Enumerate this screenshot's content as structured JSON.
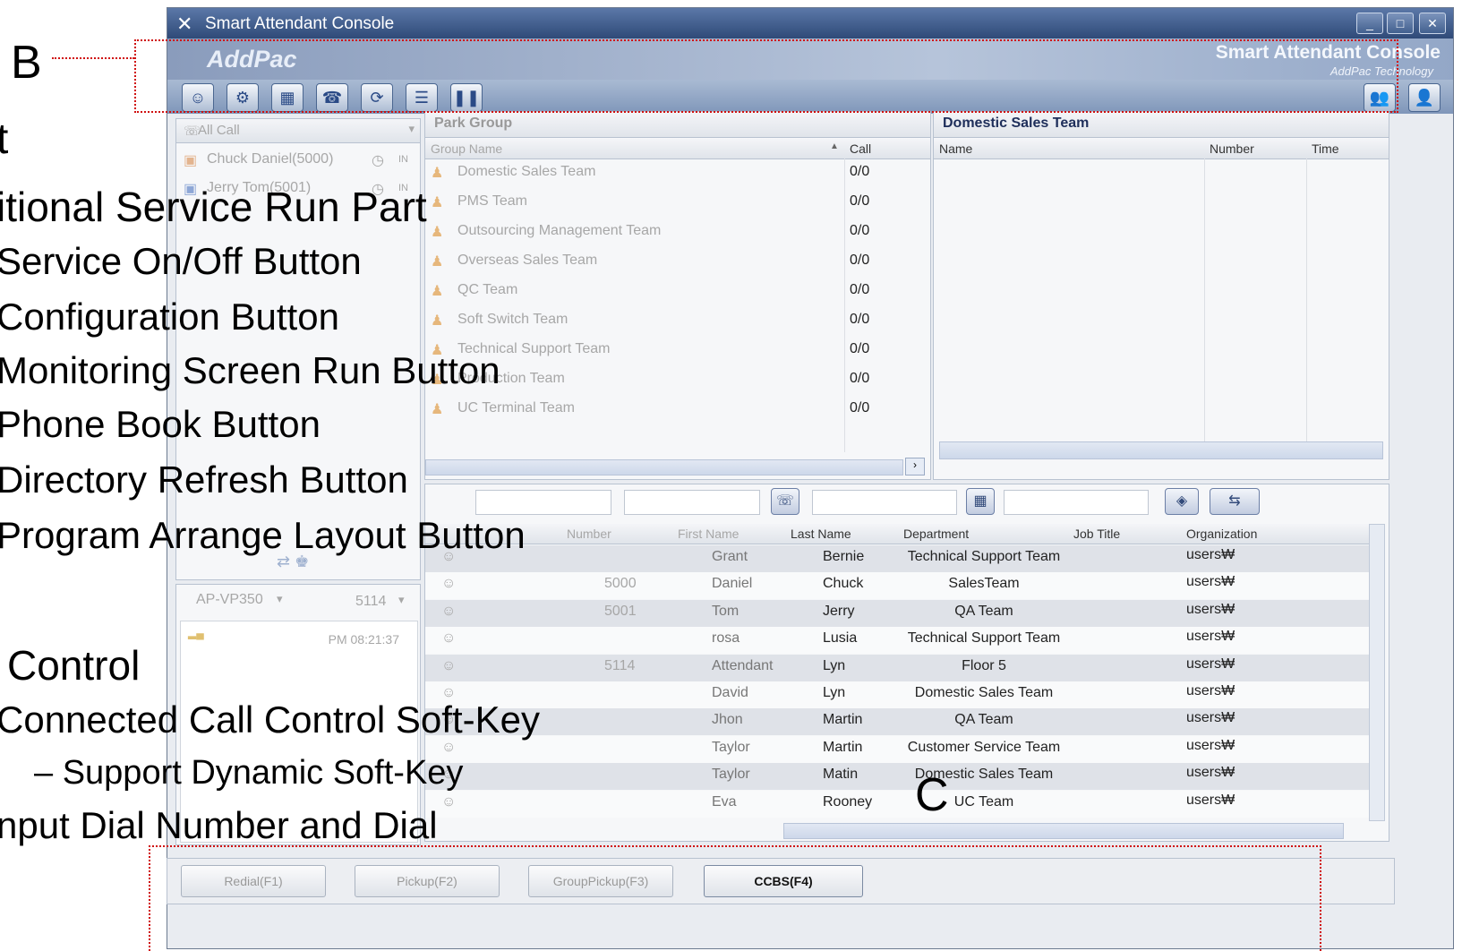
{
  "window": {
    "title": "Smart Attendant Console",
    "logo": "AddPac",
    "product_name": "Smart Attendant Console",
    "product_sub": "AddPac Technology",
    "controls": [
      "_",
      "□",
      "✕"
    ]
  },
  "left_panel": {
    "filter": "All Call",
    "calls": [
      {
        "name": "Chuck Daniel(5000)",
        "badge": "IN"
      },
      {
        "name": "Jerry Tom(5001)",
        "badge": "IN"
      }
    ],
    "phone_model": "AP-VP350",
    "extension": "5114",
    "clock": "PM 08:21:37"
  },
  "park_group": {
    "title": "Park Group",
    "col_name": "Group Name",
    "col_call": "Call",
    "rows": [
      {
        "name": "Domestic Sales Team",
        "call": "0/0"
      },
      {
        "name": "PMS Team",
        "call": "0/0"
      },
      {
        "name": "Outsourcing Management Team",
        "call": "0/0"
      },
      {
        "name": "Overseas Sales Team",
        "call": "0/0"
      },
      {
        "name": "QC Team",
        "call": "0/0"
      },
      {
        "name": "Soft Switch Team",
        "call": "0/0"
      },
      {
        "name": "Technical Support Team",
        "call": "0/0"
      },
      {
        "name": "Production Team",
        "call": "0/0"
      },
      {
        "name": "UC Terminal Team",
        "call": "0/0"
      }
    ]
  },
  "detail_panel": {
    "title": "Domestic Sales Team",
    "col_name": "Name",
    "col_number": "Number",
    "col_time": "Time"
  },
  "directory": {
    "columns": [
      "Number",
      "First Name",
      "Last Name",
      "Department",
      "Job Title",
      "Organization"
    ],
    "rows": [
      {
        "number": "",
        "first": "Grant",
        "last": "Bernie",
        "dept": "Technical Support Team",
        "org": "users₩"
      },
      {
        "number": "5000",
        "first": "Daniel",
        "last": "Chuck",
        "dept": "SalesTeam",
        "org": "users₩"
      },
      {
        "number": "5001",
        "first": "Tom",
        "last": "Jerry",
        "dept": "QA Team",
        "org": "users₩"
      },
      {
        "number": "",
        "first": "rosa",
        "last": "Lusia",
        "dept": "Technical Support Team",
        "org": "users₩"
      },
      {
        "number": "5114",
        "first": "Attendant",
        "last": "Lyn",
        "dept": "Floor 5",
        "org": "users₩"
      },
      {
        "number": "",
        "first": "David",
        "last": "Lyn",
        "dept": "Domestic Sales Team",
        "org": "users₩"
      },
      {
        "number": "",
        "first": "Jhon",
        "last": "Martin",
        "dept": "QA Team",
        "org": "users₩"
      },
      {
        "number": "",
        "first": "Taylor",
        "last": "Martin",
        "dept": "Customer Service Team",
        "org": "users₩"
      },
      {
        "number": "",
        "first": "Taylor",
        "last": "Matin",
        "dept": "Domestic Sales Team",
        "org": "users₩"
      },
      {
        "number": "",
        "first": "Eva",
        "last": "Rooney",
        "dept": "UC Team",
        "org": "users₩"
      }
    ]
  },
  "softkeys": [
    "Redial(F1)",
    "Pickup(F2)",
    "GroupPickup(F3)",
    "CCBS(F4)"
  ],
  "overlay": {
    "label_b": "B",
    "label_c": "C",
    "l1": "t",
    "l2": "itional Service Run Part",
    "l3": "Service On/Off Button",
    "l4": "Configuration Button",
    "l5": "Monitoring Screen Run Button",
    "l6": "Phone Book Button",
    "l7": "Directory Refresh Button",
    "l8": "Program Arrange Layout Button",
    "l9": "Control",
    "l10": "Connected Call Control Soft-Key",
    "l11": "–  Support Dynamic Soft-Key",
    "l12": "nput Dial Number and Dial"
  }
}
